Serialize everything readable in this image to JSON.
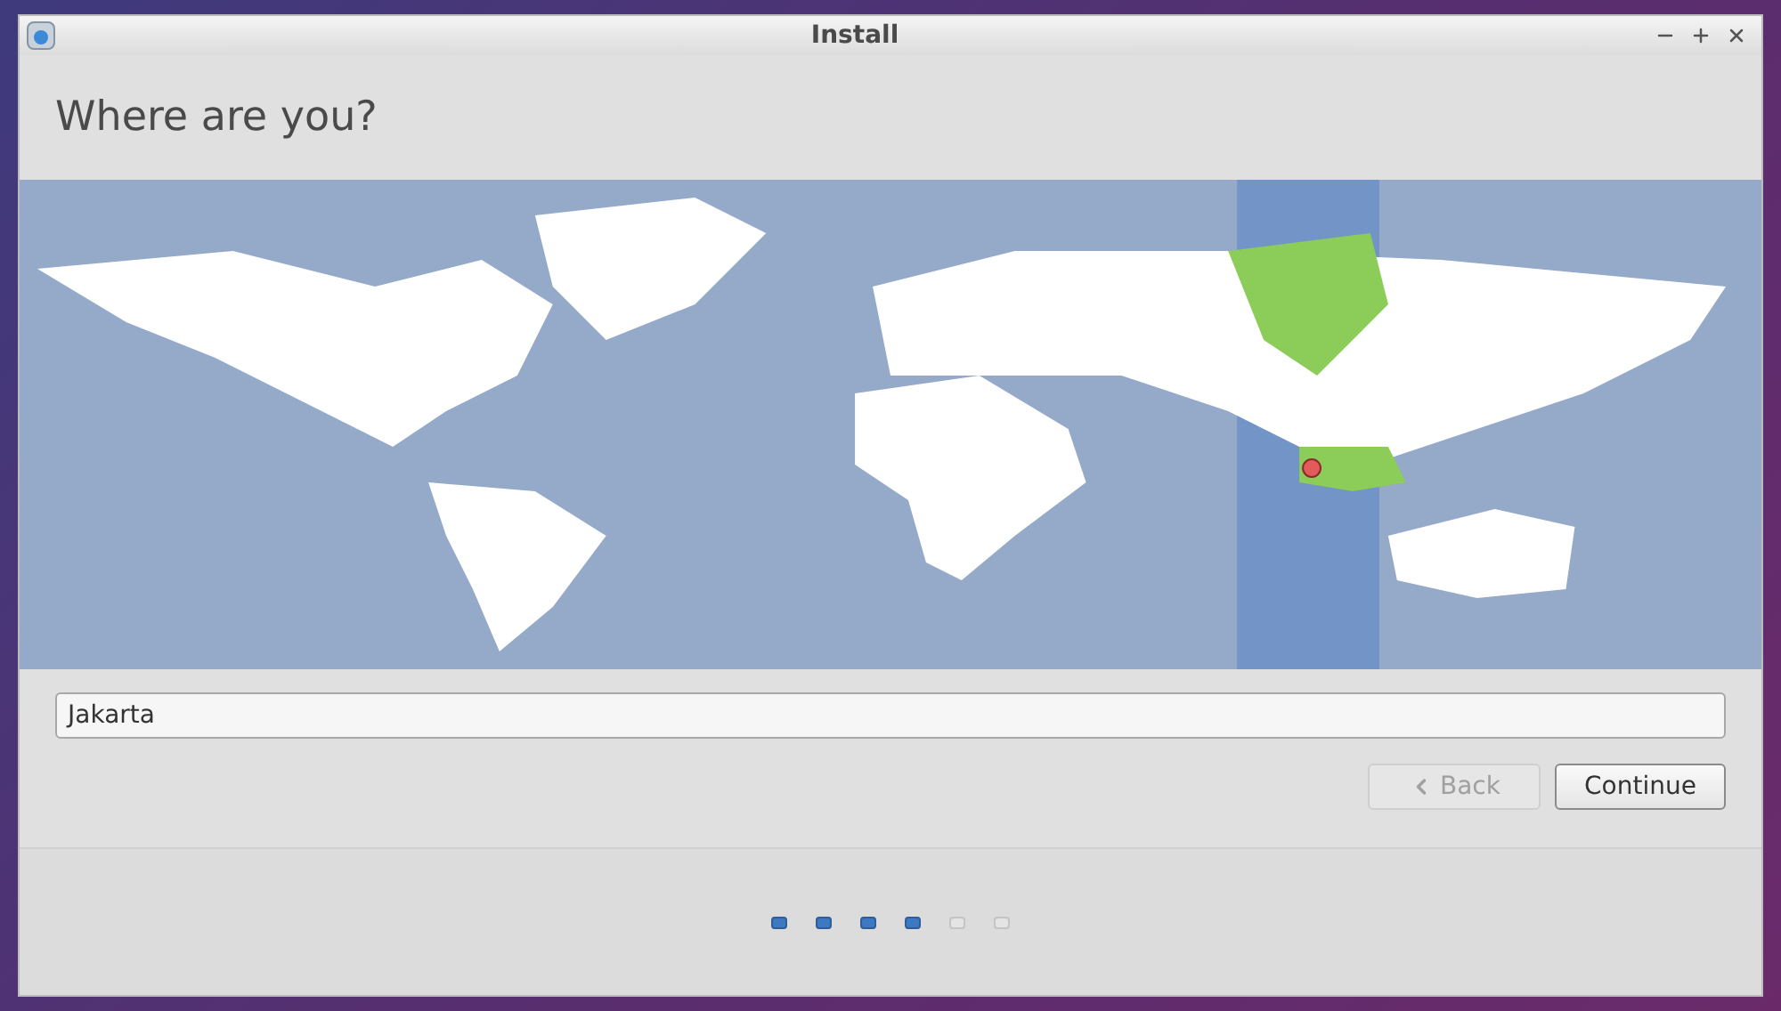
{
  "window": {
    "title": "Install"
  },
  "heading": "Where are you?",
  "location_field": {
    "value": "Jakarta"
  },
  "buttons": [
    {
      "kind": "back",
      "label": "Back",
      "disabled": true
    },
    {
      "kind": "continue",
      "label": "Continue",
      "disabled": false
    }
  ],
  "progress_steps": [
    {
      "completed": true
    },
    {
      "completed": true
    },
    {
      "completed": true
    },
    {
      "completed": true
    },
    {
      "completed": false
    },
    {
      "completed": false
    }
  ]
}
